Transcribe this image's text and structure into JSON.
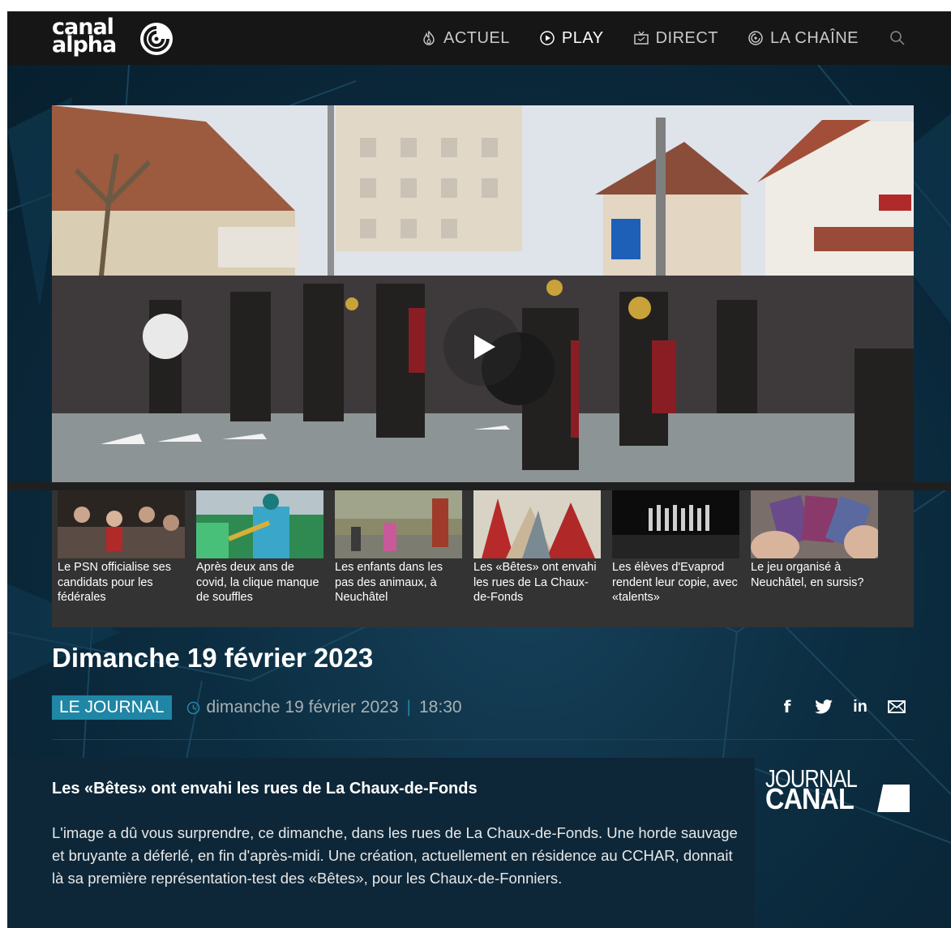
{
  "header": {
    "logo_line1": "canal",
    "logo_line2": "alpha",
    "nav": [
      {
        "label": "ACTUEL",
        "icon": "flame-icon",
        "active": false
      },
      {
        "label": "PLAY",
        "icon": "play-circle-icon",
        "active": true
      },
      {
        "label": "DIRECT",
        "icon": "tv-icon",
        "active": false
      },
      {
        "label": "LA CHAÎNE",
        "icon": "canal-swirl-icon",
        "active": false
      }
    ],
    "search_icon": "search-icon"
  },
  "video": {
    "play_icon": "play-icon"
  },
  "thumbnails": [
    {
      "caption": "Le PSN officialise ses candidats pour les fédérales"
    },
    {
      "caption": "Après deux ans de covid, la clique manque de souffles"
    },
    {
      "caption": "Les enfants dans les pas des animaux, à Neuchâtel"
    },
    {
      "caption": "Les «Bêtes» ont envahi les rues de La Chaux-de-Fonds"
    },
    {
      "caption": "Les élèves d'Evaprod rendent leur copie, avec «talents»"
    },
    {
      "caption": "Le jeu organisé à Neuchâtel, en sursis?"
    }
  ],
  "episode": {
    "title": "Dimanche 19 février 2023",
    "category": "LE JOURNAL",
    "date": "dimanche 19 février 2023",
    "separator": "|",
    "time": "18:30"
  },
  "share": {
    "facebook": "f",
    "linkedin": "in"
  },
  "article": {
    "title": "Les «Bêtes» ont envahi les rues de La Chaux-de-Fonds",
    "body": "L'image a dû vous surprendre, ce dimanche, dans les rues de La Chaux-de-Fonds. Une horde sauvage et bruyante a déferlé, en fin d'après-midi. Une création, actuellement en résidence au CCHAR, donnait là sa première représentation-test des «Bêtes», pour les Chaux-de-Fonniers."
  },
  "journal_logo": {
    "line1": "JOURNAL",
    "line2": "CANAL"
  },
  "colors": {
    "accent": "#1f86a5",
    "header_bg": "#161616",
    "page_bg": "#0b2a3d"
  }
}
